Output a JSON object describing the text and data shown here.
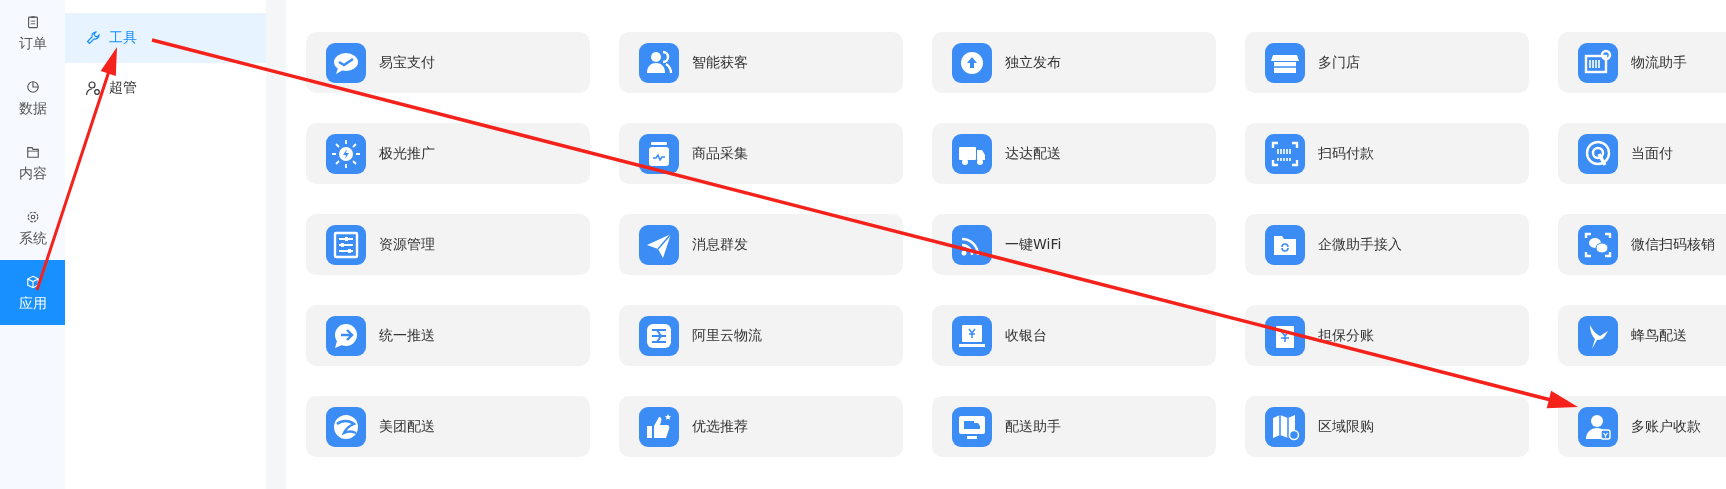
{
  "rail": [
    {
      "label": "订单",
      "selected": false
    },
    {
      "label": "数据",
      "selected": false
    },
    {
      "label": "内容",
      "selected": false
    },
    {
      "label": "系统",
      "selected": false
    },
    {
      "label": "应用",
      "selected": true
    }
  ],
  "submenu": [
    {
      "label": "工具",
      "selected": true
    },
    {
      "label": "超管",
      "selected": false
    }
  ],
  "apps": [
    {
      "label": "易宝支付"
    },
    {
      "label": "智能获客"
    },
    {
      "label": "独立发布"
    },
    {
      "label": "多门店"
    },
    {
      "label": "物流助手"
    },
    {
      "label": "极光推广"
    },
    {
      "label": "商品采集"
    },
    {
      "label": "达达配送"
    },
    {
      "label": "扫码付款"
    },
    {
      "label": "当面付"
    },
    {
      "label": "资源管理"
    },
    {
      "label": "消息群发"
    },
    {
      "label": "一键WiFi"
    },
    {
      "label": "企微助手接入"
    },
    {
      "label": "微信扫码核销"
    },
    {
      "label": "统一推送"
    },
    {
      "label": "阿里云物流"
    },
    {
      "label": "收银台"
    },
    {
      "label": "担保分账"
    },
    {
      "label": "蜂鸟配送"
    },
    {
      "label": "美团配送"
    },
    {
      "label": "优选推荐"
    },
    {
      "label": "配送助手"
    },
    {
      "label": "区域限购"
    },
    {
      "label": "多账户收款"
    }
  ]
}
